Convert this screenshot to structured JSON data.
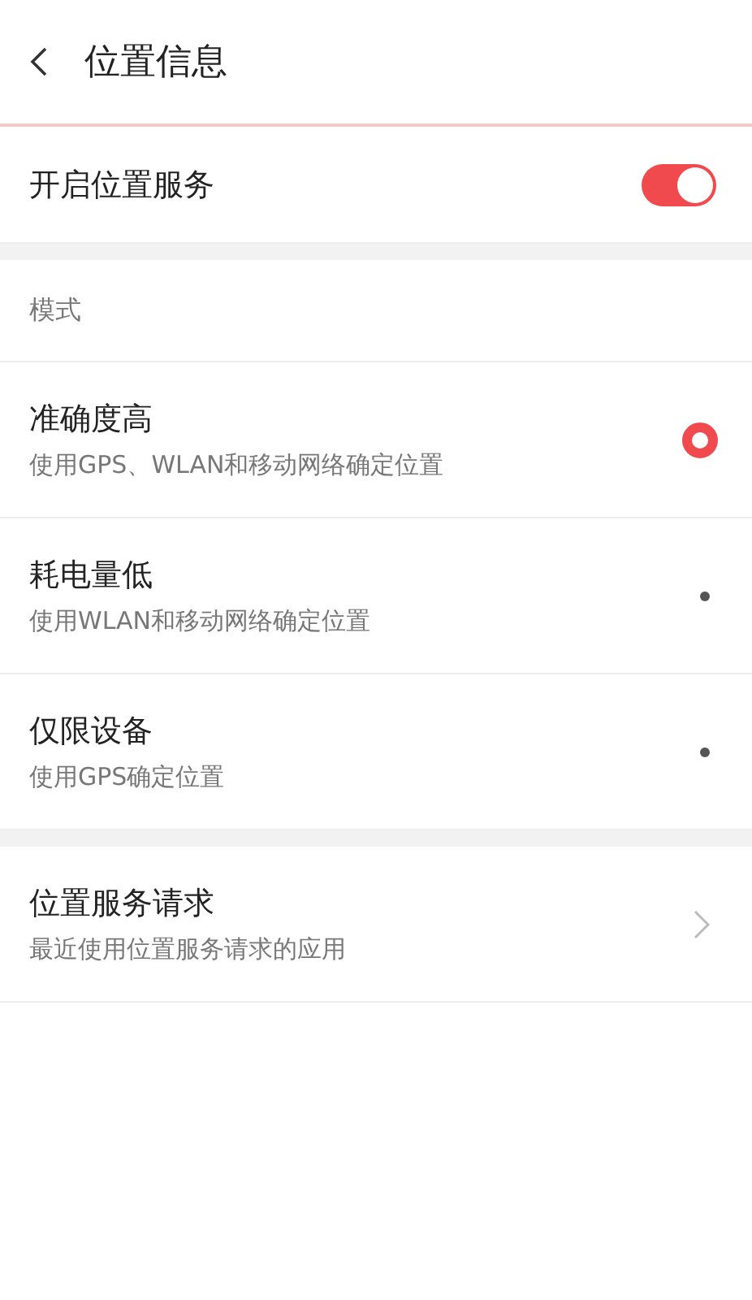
{
  "header": {
    "title": "位置信息"
  },
  "location_service": {
    "label": "开启位置服务",
    "on": true
  },
  "mode_section": {
    "title": "模式",
    "options": [
      {
        "title": "准确度高",
        "subtitle": "使用GPS、WLAN和移动网络确定位置",
        "selected": true
      },
      {
        "title": "耗电量低",
        "subtitle": "使用WLAN和移动网络确定位置",
        "selected": false
      },
      {
        "title": "仅限设备",
        "subtitle": "使用GPS确定位置",
        "selected": false
      }
    ]
  },
  "requests": {
    "title": "位置服务请求",
    "subtitle": "最近使用位置服务请求的应用"
  }
}
